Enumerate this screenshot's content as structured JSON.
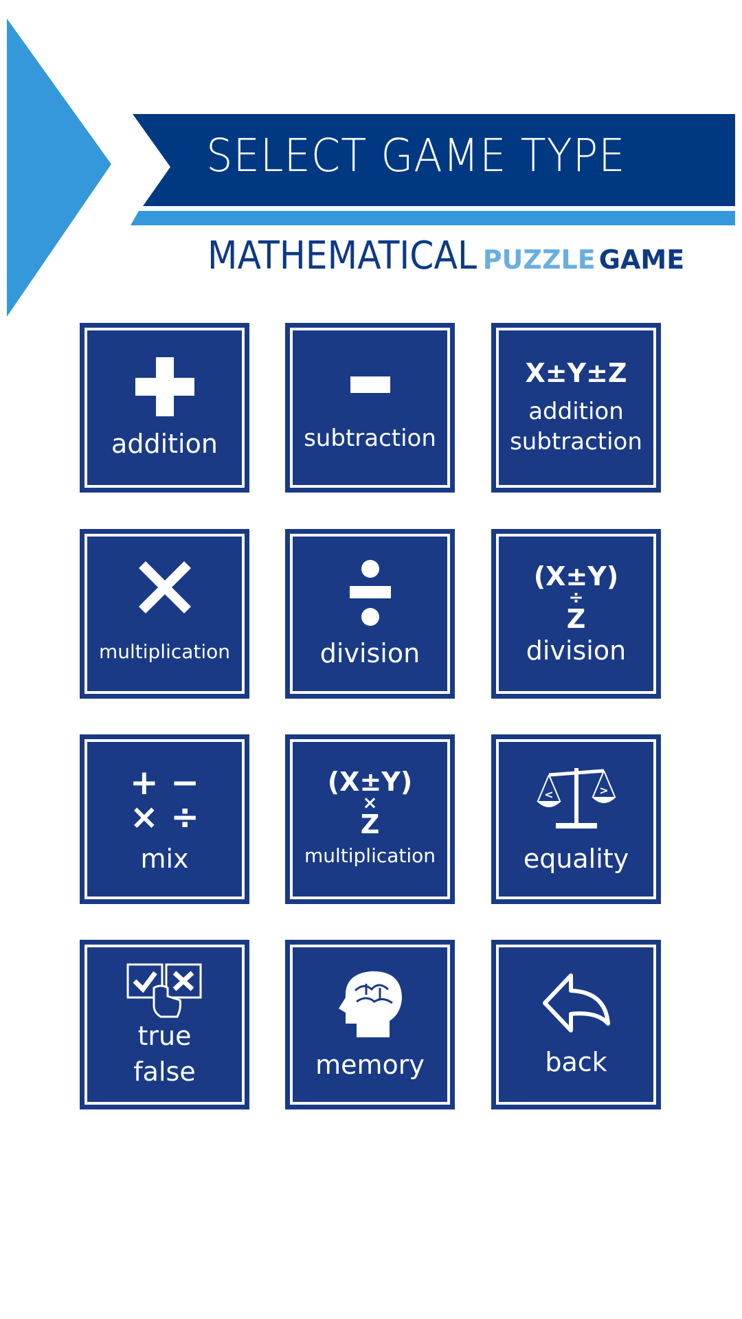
{
  "header": {
    "title": "SELECT GAME TYPE",
    "subtitle_main": "MATHEMATICAL",
    "subtitle_puzzle": "PUZZLE",
    "subtitle_game": "GAME"
  },
  "colors": {
    "dark_blue": "#003882",
    "light_blue": "#3498db",
    "tile_blue": "#1a3a86"
  },
  "tiles": [
    {
      "label": "addition",
      "icon": "plus-icon",
      "glyph": "+"
    },
    {
      "label": "subtraction",
      "icon": "minus-icon",
      "glyph": "−"
    },
    {
      "label": "addition subtraction",
      "line1": "addition",
      "line2": "subtraction",
      "icon": "xyz-formula-icon",
      "glyph": "X±Y±Z"
    },
    {
      "label": "multiplication",
      "icon": "times-icon",
      "glyph": "✕"
    },
    {
      "label": "division",
      "icon": "divide-icon",
      "glyph": "÷"
    },
    {
      "label": "division",
      "icon": "xy-over-z-formula-icon",
      "f1": "(X±Y)",
      "f2": "÷",
      "f3": "Z"
    },
    {
      "label": "mix",
      "icon": "mixed-operators-icon",
      "g1": "+ −",
      "g2": "× ÷"
    },
    {
      "label": "multiplication",
      "icon": "xy-times-z-formula-icon",
      "f1": "(X±Y)",
      "f2": "×",
      "f3": "Z"
    },
    {
      "label": "equality",
      "icon": "balance-scale-icon",
      "left": "<",
      "right": ">"
    },
    {
      "label": "true false",
      "line1": "true",
      "line2": "false",
      "icon": "checkbox-hand-icon"
    },
    {
      "label": "memory",
      "icon": "brain-head-icon"
    },
    {
      "label": "back",
      "icon": "back-arrow-icon"
    }
  ]
}
